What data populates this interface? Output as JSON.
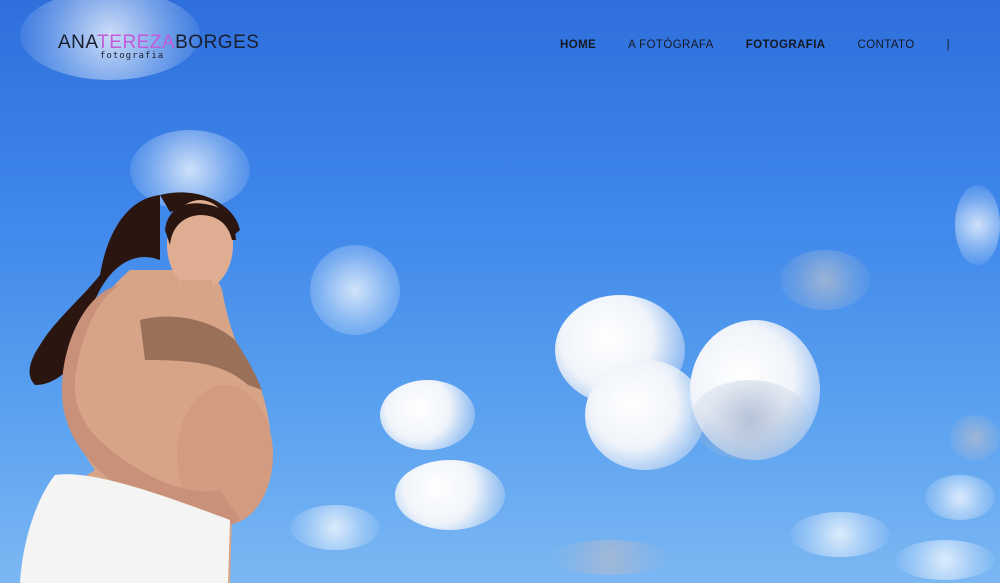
{
  "logo": {
    "part1": "ANA",
    "part2": "TEREZA",
    "part3": "BORGES",
    "subtitle": "fotografia"
  },
  "nav": {
    "items": [
      {
        "label": "HOME"
      },
      {
        "label": "A FOTÓGRAFA"
      },
      {
        "label": "FOTOGRAFIA"
      },
      {
        "label": "CONTATO"
      },
      {
        "label": "|"
      }
    ]
  },
  "colors": {
    "sky": "#3e86ea",
    "accent": "#c35bd9",
    "text": "#141824"
  },
  "hero": {
    "icon": "maternity-photo"
  }
}
